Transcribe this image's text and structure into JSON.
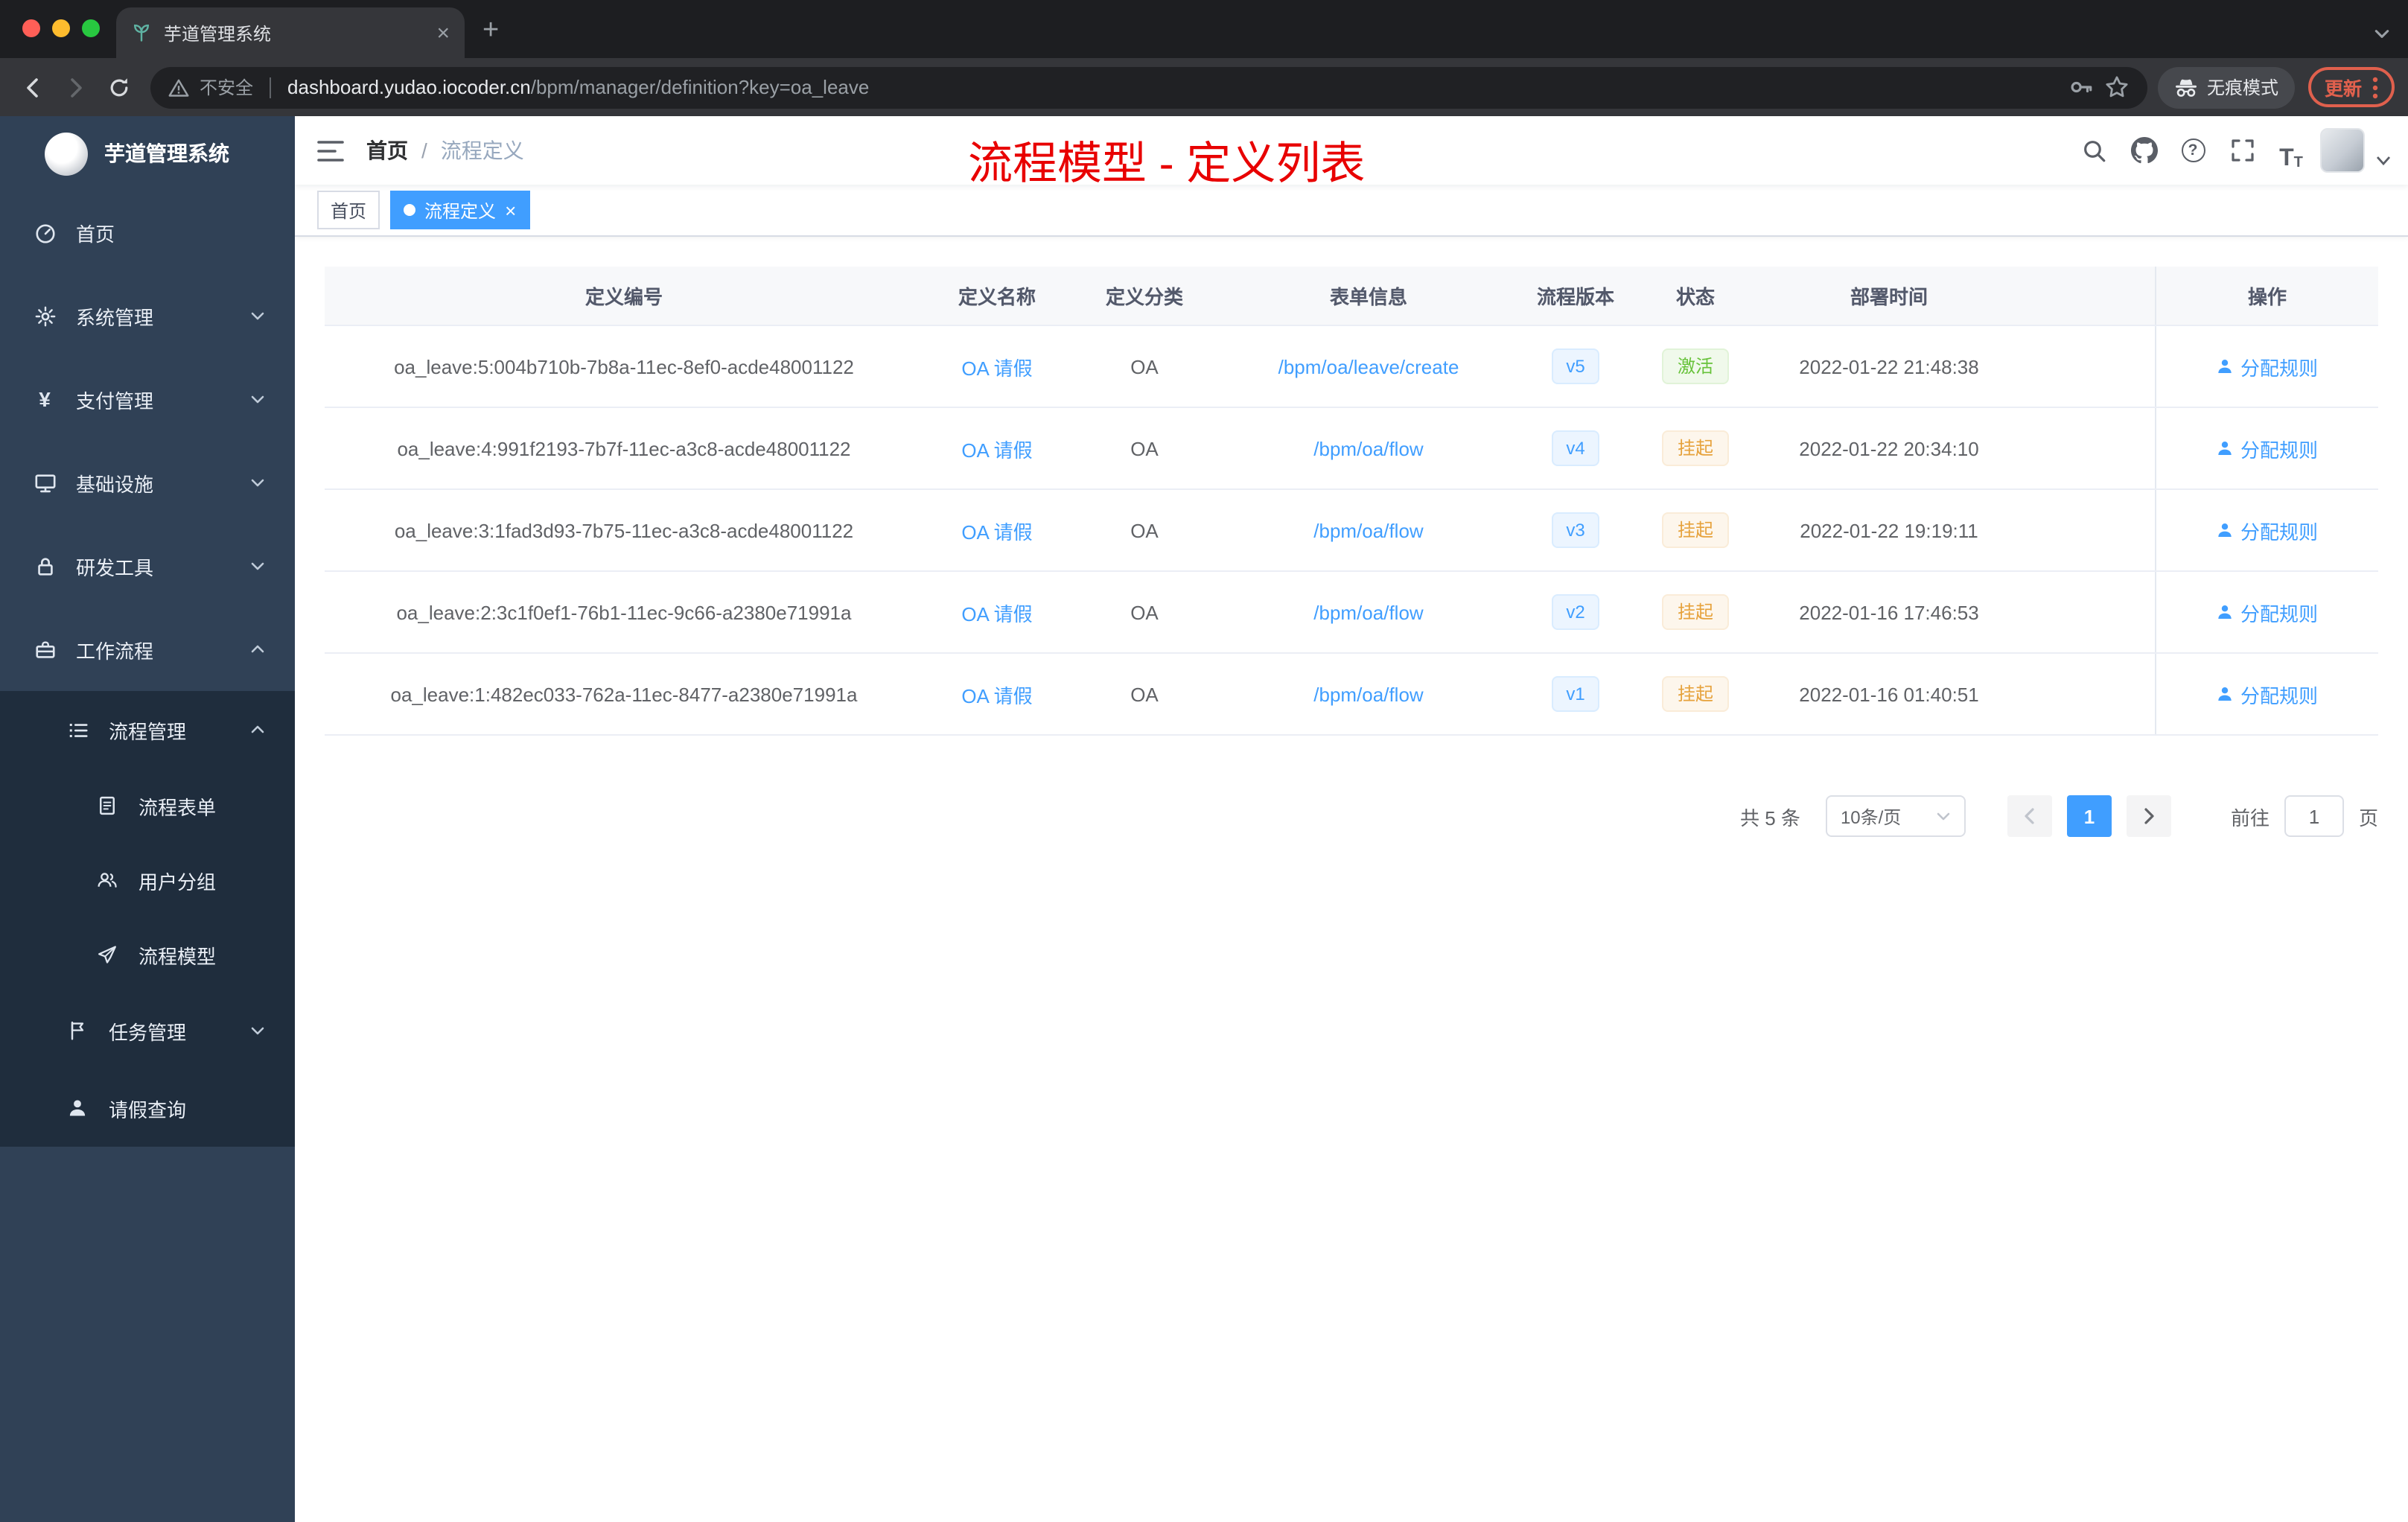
{
  "colors": {
    "accent": "#409eff",
    "success": "#67c23a",
    "warning": "#e6a23c",
    "annotation_red": "#e80000",
    "sidebar_bg": "#304156",
    "submenu_bg": "#1f2d3d"
  },
  "browser": {
    "tab_title": "芋道管理系统",
    "security_label": "不安全",
    "url_domain": "dashboard.yudao.iocoder.cn",
    "url_path": "/bpm/manager/definition?key=oa_leave",
    "incognito_label": "无痕模式",
    "update_label": "更新"
  },
  "sidebar": {
    "logo_title": "芋道管理系统",
    "items": [
      {
        "label": "首页"
      },
      {
        "label": "系统管理"
      },
      {
        "label": "支付管理"
      },
      {
        "label": "基础设施"
      },
      {
        "label": "研发工具"
      },
      {
        "label": "工作流程"
      },
      {
        "label": "流程管理"
      },
      {
        "label": "流程表单"
      },
      {
        "label": "用户分组"
      },
      {
        "label": "流程模型"
      },
      {
        "label": "任务管理"
      },
      {
        "label": "请假查询"
      }
    ]
  },
  "header": {
    "breadcrumb": {
      "home": "首页",
      "separator": "/",
      "current": "流程定义"
    },
    "annotation": "流程模型 - 定义列表"
  },
  "tags_view": {
    "tags": [
      {
        "label": "首页",
        "active": false
      },
      {
        "label": "流程定义",
        "active": true
      }
    ]
  },
  "table": {
    "columns": [
      "定义编号",
      "定义名称",
      "定义分类",
      "表单信息",
      "流程版本",
      "状态",
      "部署时间",
      "操作"
    ],
    "rows": [
      {
        "id": "oa_leave:5:004b710b-7b8a-11ec-8ef0-acde48001122",
        "name": "OA 请假",
        "category": "OA",
        "form": "/bpm/oa/leave/create",
        "version": "v5",
        "status": "激活",
        "status_type": "success",
        "deploy_time": "2022-01-22 21:48:38",
        "action": "分配规则"
      },
      {
        "id": "oa_leave:4:991f2193-7b7f-11ec-a3c8-acde48001122",
        "name": "OA 请假",
        "category": "OA",
        "form": "/bpm/oa/flow",
        "version": "v4",
        "status": "挂起",
        "status_type": "warning",
        "deploy_time": "2022-01-22 20:34:10",
        "action": "分配规则"
      },
      {
        "id": "oa_leave:3:1fad3d93-7b75-11ec-a3c8-acde48001122",
        "name": "OA 请假",
        "category": "OA",
        "form": "/bpm/oa/flow",
        "version": "v3",
        "status": "挂起",
        "status_type": "warning",
        "deploy_time": "2022-01-22 19:19:11",
        "action": "分配规则"
      },
      {
        "id": "oa_leave:2:3c1f0ef1-76b1-11ec-9c66-a2380e71991a",
        "name": "OA 请假",
        "category": "OA",
        "form": "/bpm/oa/flow",
        "version": "v2",
        "status": "挂起",
        "status_type": "warning",
        "deploy_time": "2022-01-16 17:46:53",
        "action": "分配规则"
      },
      {
        "id": "oa_leave:1:482ec033-762a-11ec-8477-a2380e71991a",
        "name": "OA 请假",
        "category": "OA",
        "form": "/bpm/oa/flow",
        "version": "v1",
        "status": "挂起",
        "status_type": "warning",
        "deploy_time": "2022-01-16 01:40:51",
        "action": "分配规则"
      }
    ]
  },
  "pagination": {
    "total": "共 5 条",
    "page_size": "10条/页",
    "current_page": "1",
    "goto_label": "前往",
    "goto_value": "1",
    "unit_label": "页"
  }
}
